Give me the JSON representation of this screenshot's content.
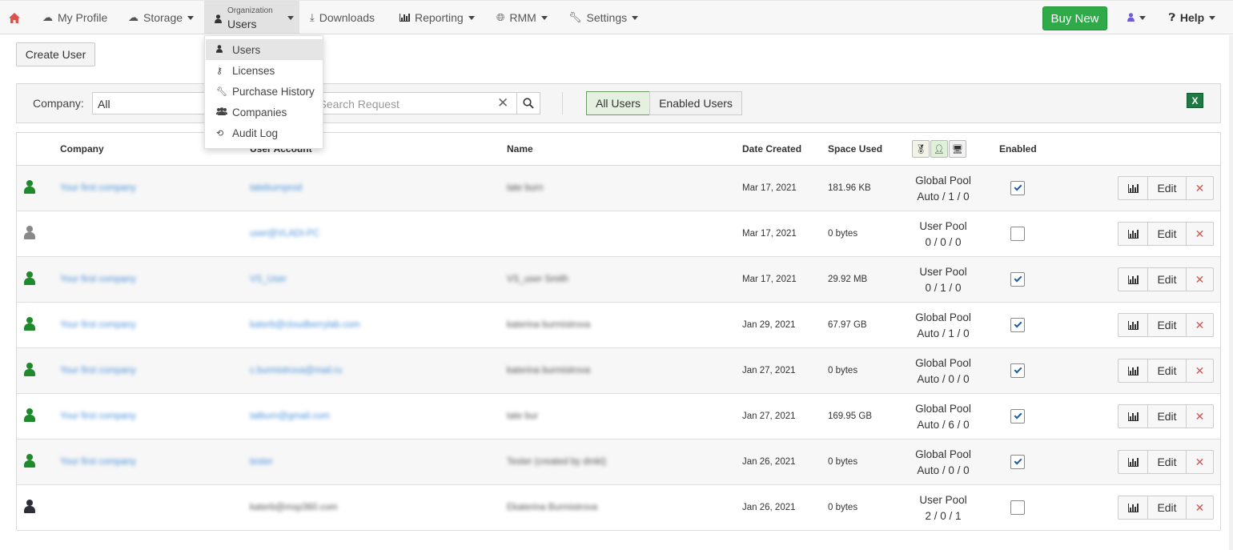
{
  "nav": {
    "my_profile": "My Profile",
    "storage": "Storage",
    "org_small": "Organization",
    "org_big": "Users",
    "downloads": "Downloads",
    "reporting": "Reporting",
    "rmm": "RMM",
    "settings": "Settings",
    "buy_new": "Buy New",
    "help": "Help"
  },
  "dropdown": {
    "items": [
      {
        "label": "Users",
        "icon": "user-icon",
        "active": true
      },
      {
        "label": "Licenses",
        "icon": "key-icon"
      },
      {
        "label": "Purchase History",
        "icon": "wrench-icon"
      },
      {
        "label": "Companies",
        "icon": "users-group-icon"
      },
      {
        "label": "Audit Log",
        "icon": "history-icon"
      }
    ]
  },
  "toolbar": {
    "create_user": "Create User"
  },
  "filter": {
    "company_label": "Company:",
    "company_value": "All",
    "search_placeholder": "r Search Request",
    "all_users": "All Users",
    "enabled_users": "Enabled Users"
  },
  "table": {
    "headers": {
      "company": "Company",
      "user_account": "User Account",
      "name": "Name",
      "date_created": "Date Created",
      "space_used": "Space Used",
      "enabled": "Enabled"
    },
    "action_edit": "Edit",
    "rows": [
      {
        "status_color": "#1f8a2b",
        "company": "Your first company",
        "account": "tateburnprod",
        "name": "tate burn",
        "date": "Mar 17, 2021",
        "space": "181.96 KB",
        "pool": "Global Pool",
        "pool_counts": "Auto / 1 / 0",
        "enabled": true
      },
      {
        "status_color": "#888888",
        "company": "",
        "account": "user@VLADI-PC",
        "name": "",
        "date": "Mar 17, 2021",
        "space": "0 bytes",
        "pool": "User Pool",
        "pool_counts": "0 / 0 / 0",
        "enabled": false
      },
      {
        "status_color": "#1f8a2b",
        "company": "Your first company",
        "account": "VS_User",
        "name": "VS_user Smith",
        "date": "Mar 17, 2021",
        "space": "29.92 MB",
        "pool": "User Pool",
        "pool_counts": "0 / 1 / 0",
        "enabled": true
      },
      {
        "status_color": "#1f8a2b",
        "company": "Your first company",
        "account": "katerb@cloudberrylab.com",
        "name": "katerina burmistrova",
        "date": "Jan 29, 2021",
        "space": "67.97 GB",
        "pool": "Global Pool",
        "pool_counts": "Auto / 1 / 0",
        "enabled": true
      },
      {
        "status_color": "#1f8a2b",
        "company": "Your first company",
        "account": "c.burmistrova@mail.ru",
        "name": "katerina burmistrova",
        "date": "Jan 27, 2021",
        "space": "0 bytes",
        "pool": "Global Pool",
        "pool_counts": "Auto / 0 / 0",
        "enabled": true
      },
      {
        "status_color": "#1f8a2b",
        "company": "Your first company",
        "account": "tatburn@gmail.com",
        "name": "tate bur",
        "date": "Jan 27, 2021",
        "space": "169.95 GB",
        "pool": "Global Pool",
        "pool_counts": "Auto / 6 / 0",
        "enabled": true
      },
      {
        "status_color": "#1f8a2b",
        "company": "Your first company",
        "account": "tester",
        "name": "Tester (created by dmkt)",
        "date": "Jan 26, 2021",
        "space": "0 bytes",
        "pool": "Global Pool",
        "pool_counts": "Auto / 0 / 0",
        "enabled": true
      },
      {
        "status_color": "#2e2e3a",
        "company": "",
        "account": "katerb@msp360.com",
        "name": "Ekaterina Burmistrova",
        "date": "Jan 26, 2021",
        "space": "0 bytes",
        "pool": "User Pool",
        "pool_counts": "2 / 0 / 1",
        "enabled": false
      }
    ]
  },
  "colors": {
    "accent_green": "#2eaa48",
    "link_blue": "#4a90d9",
    "delete_red": "#d9534f"
  }
}
